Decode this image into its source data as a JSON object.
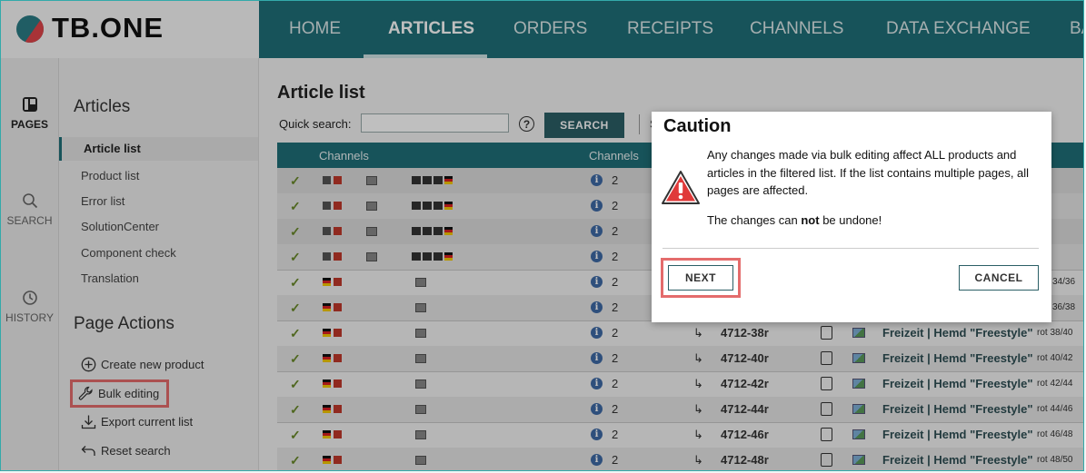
{
  "app": {
    "logo": "TB.ONE"
  },
  "topnav": {
    "items": [
      {
        "label": "HOME"
      },
      {
        "label": "ARTICLES"
      },
      {
        "label": "ORDERS"
      },
      {
        "label": "RECEIPTS"
      },
      {
        "label": "CHANNELS"
      },
      {
        "label": "DATA EXCHANGE"
      },
      {
        "label": "BA"
      }
    ]
  },
  "rail": {
    "pages": "PAGES",
    "search": "SEARCH",
    "history": "HISTORY"
  },
  "sidebar": {
    "title": "Articles",
    "links": [
      {
        "label": "Article list"
      },
      {
        "label": "Product list"
      },
      {
        "label": "Error list"
      },
      {
        "label": "SolutionCenter"
      },
      {
        "label": "Component check"
      },
      {
        "label": "Translation"
      }
    ],
    "actions_title": "Page Actions",
    "actions": [
      {
        "label": "Create new product"
      },
      {
        "label": "Bulk editing"
      },
      {
        "label": "Export current list"
      },
      {
        "label": "Reset search"
      }
    ]
  },
  "main": {
    "title": "Article list",
    "quick_search_label": "Quick search:",
    "search_button": "SEARCH",
    "sep_letter": "S",
    "columns": {
      "channels1": "Channels",
      "channels2": "Channels"
    },
    "rows": [
      {
        "count": "2"
      },
      {
        "count": "2"
      },
      {
        "count": "2"
      },
      {
        "count": "2"
      },
      {
        "count": "2",
        "variant": "34/36"
      },
      {
        "count": "2",
        "variant": "36/38"
      },
      {
        "count": "2",
        "article": "4712-38r",
        "product": "Freizeit | Hemd \"Freestyle\"",
        "variant": "rot 38/40"
      },
      {
        "count": "2",
        "article": "4712-40r",
        "product": "Freizeit | Hemd \"Freestyle\"",
        "variant": "rot 40/42"
      },
      {
        "count": "2",
        "article": "4712-42r",
        "product": "Freizeit | Hemd \"Freestyle\"",
        "variant": "rot 42/44"
      },
      {
        "count": "2",
        "article": "4712-44r",
        "product": "Freizeit | Hemd \"Freestyle\"",
        "variant": "rot 44/46"
      },
      {
        "count": "2",
        "article": "4712-46r",
        "product": "Freizeit | Hemd \"Freestyle\"",
        "variant": "rot 46/48"
      },
      {
        "count": "2",
        "article": "4712-48r",
        "product": "Freizeit | Hemd \"Freestyle\"",
        "variant": "rot 48/50"
      }
    ]
  },
  "dialog": {
    "title": "Caution",
    "text": "Any changes made via bulk editing affect ALL products and articles in the filtered list. If the list contains multiple pages, all pages are affected.",
    "undo_pre": "The changes can ",
    "undo_bold": "not",
    "undo_post": " be undone!",
    "next": "NEXT",
    "cancel": "CANCEL"
  },
  "colors": {
    "teal": "#1f6f78",
    "highlight": "#e46c6c"
  }
}
